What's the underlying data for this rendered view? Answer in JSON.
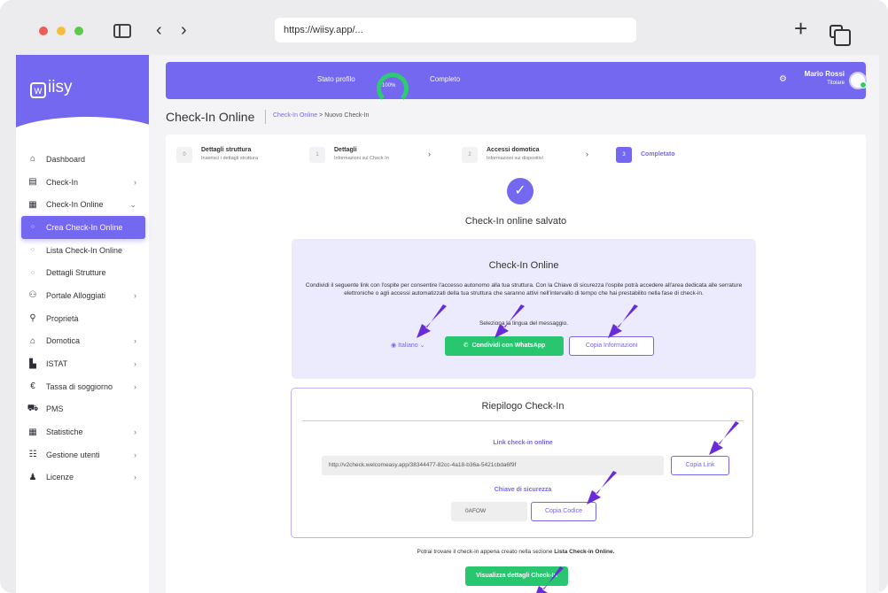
{
  "browser": {
    "url": "https://wiisy.app/..."
  },
  "brand": {
    "logo_text": "iisy",
    "accent": "#7467f0",
    "success": "#28c76f"
  },
  "sidebar": {
    "items": [
      {
        "label": "Dashboard",
        "icon": "home-icon"
      },
      {
        "label": "Check-In",
        "icon": "document-icon",
        "chevron": "›"
      },
      {
        "label": "Check-In Online",
        "icon": "calendar-icon",
        "chevron": "⌄"
      },
      {
        "label": "Crea Check-In Online",
        "icon": "circle-icon",
        "active": true
      },
      {
        "label": "Lista Check-In Online",
        "icon": "circle-icon"
      },
      {
        "label": "Dettagli Strutture",
        "icon": "circle-icon"
      },
      {
        "label": "Portale Alloggiati",
        "icon": "users-icon",
        "chevron": "›"
      },
      {
        "label": "Proprietà",
        "icon": "location-pin-icon"
      },
      {
        "label": "Domotica",
        "icon": "smart-home-icon",
        "chevron": "›"
      },
      {
        "label": "ISTAT",
        "icon": "chart-icon",
        "chevron": "›"
      },
      {
        "label": "Tassa di soggiorno",
        "icon": "euro-icon",
        "chevron": "›"
      },
      {
        "label": "PMS",
        "icon": "pms-icon"
      },
      {
        "label": "Statistiche",
        "icon": "table-icon",
        "chevron": "›"
      },
      {
        "label": "Gestione utenti",
        "icon": "user-group-icon",
        "chevron": "›"
      },
      {
        "label": "Licenze",
        "icon": "license-icon",
        "chevron": "›"
      }
    ]
  },
  "topbar": {
    "stato_label": "Stato profilo",
    "progress_label": "100%",
    "progress": 1.0,
    "completo_label": "Completo",
    "user_name": "Mario Rossi",
    "user_role": "Titolare"
  },
  "header": {
    "title": "Check-In Online",
    "breadcrumb_link": "Check-In Online",
    "breadcrumb_sep": ">",
    "breadcrumb_current": "Nuovo Check-In"
  },
  "stepper": [
    {
      "num": "0",
      "title": "Dettagli struttura",
      "subtitle": "Inserisci i dettagli struttura"
    },
    {
      "num": "1",
      "title": "Dettagli",
      "subtitle": "Informazioni sul Check In"
    },
    {
      "num": "2",
      "title": "Accessi domotica",
      "subtitle": "Informazioni sui dispositivi"
    },
    {
      "num": "3",
      "title": "Completato",
      "subtitle": ""
    }
  ],
  "saved_message": "Check-In online salvato",
  "share_panel": {
    "title": "Check-In Online",
    "description": "Condividi il seguente link con l'ospite per consentire l'accesso autonomo alla tua struttura. Con la Chiave di sicurezza l'ospite potrà accedere all'area dedicata alle serrature elettroniche o agli accessi automatizzati della tua struttura che saranno attivi nell'intervallo di tempo che hai prestabilito nella fase di check-in.",
    "select_language": "Seleziona la lingua del messaggio.",
    "language": "Italiano",
    "whatsapp_button": "Condividi con WhatsApp",
    "copy_info_button": "Copia Informazioni"
  },
  "summary": {
    "title": "Riepilogo Check-In",
    "link_label": "Link check-in online",
    "link_value": "http://v2check.welcomeasy.app/38344477-82cc-4a18-b36a-5421cbda6f9f",
    "copy_link_button": "Copia Link",
    "security_label": "Chiave di sicurezza",
    "security_code": "0AFOW",
    "copy_code_button": "Copia Codice"
  },
  "footer": {
    "text_before": "Potrai trovare il check-in appena creato nella sezione ",
    "text_bold": "Lista Check-in Online.",
    "view_button": "Visualizza dettagli Check-In"
  }
}
